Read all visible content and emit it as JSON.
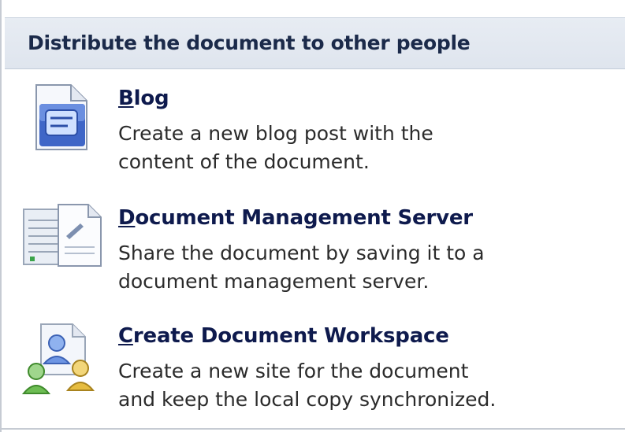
{
  "header": {
    "title": "Distribute the document to other people"
  },
  "items": [
    {
      "accel": "B",
      "rest": "log",
      "desc_line1": "Create a new blog post with the",
      "desc_line2": "content of the document.",
      "icon": "blog-document-icon"
    },
    {
      "accel": "D",
      "rest": "ocument Management Server",
      "desc_line1": "Share the document by saving it to a",
      "desc_line2": "document management server.",
      "icon": "document-management-server-icon"
    },
    {
      "accel": "C",
      "rest": "reate Document Workspace",
      "desc_line1": "Create a new site for the document",
      "desc_line2": "and keep the local copy synchronized.",
      "icon": "document-workspace-people-icon"
    }
  ]
}
